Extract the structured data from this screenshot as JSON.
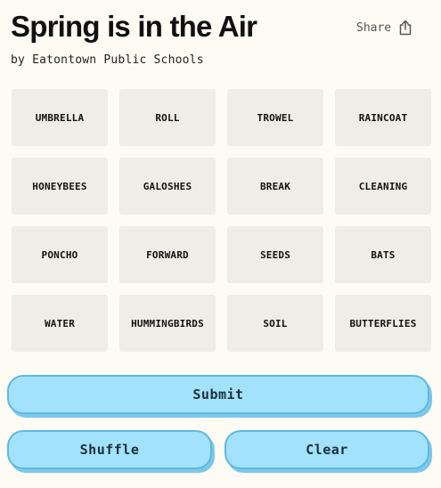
{
  "header": {
    "title": "Spring is in the Air",
    "byline": "by Eatontown Public Schools",
    "share_label": "Share",
    "share_icon": "share-icon"
  },
  "grid": {
    "tiles": [
      "UMBRELLA",
      "ROLL",
      "TROWEL",
      "RAINCOAT",
      "HONEYBEES",
      "GALOSHES",
      "BREAK",
      "CLEANING",
      "PONCHO",
      "FORWARD",
      "SEEDS",
      "BATS",
      "WATER",
      "HUMMINGBIRDS",
      "SOIL",
      "BUTTERFLIES"
    ]
  },
  "actions": {
    "submit_label": "Submit",
    "shuffle_label": "Shuffle",
    "clear_label": "Clear"
  },
  "colors": {
    "background": "#fdfbf4",
    "tile": "#eeede7",
    "button": "#a2e2fd",
    "button_border": "#5fb8e0"
  }
}
